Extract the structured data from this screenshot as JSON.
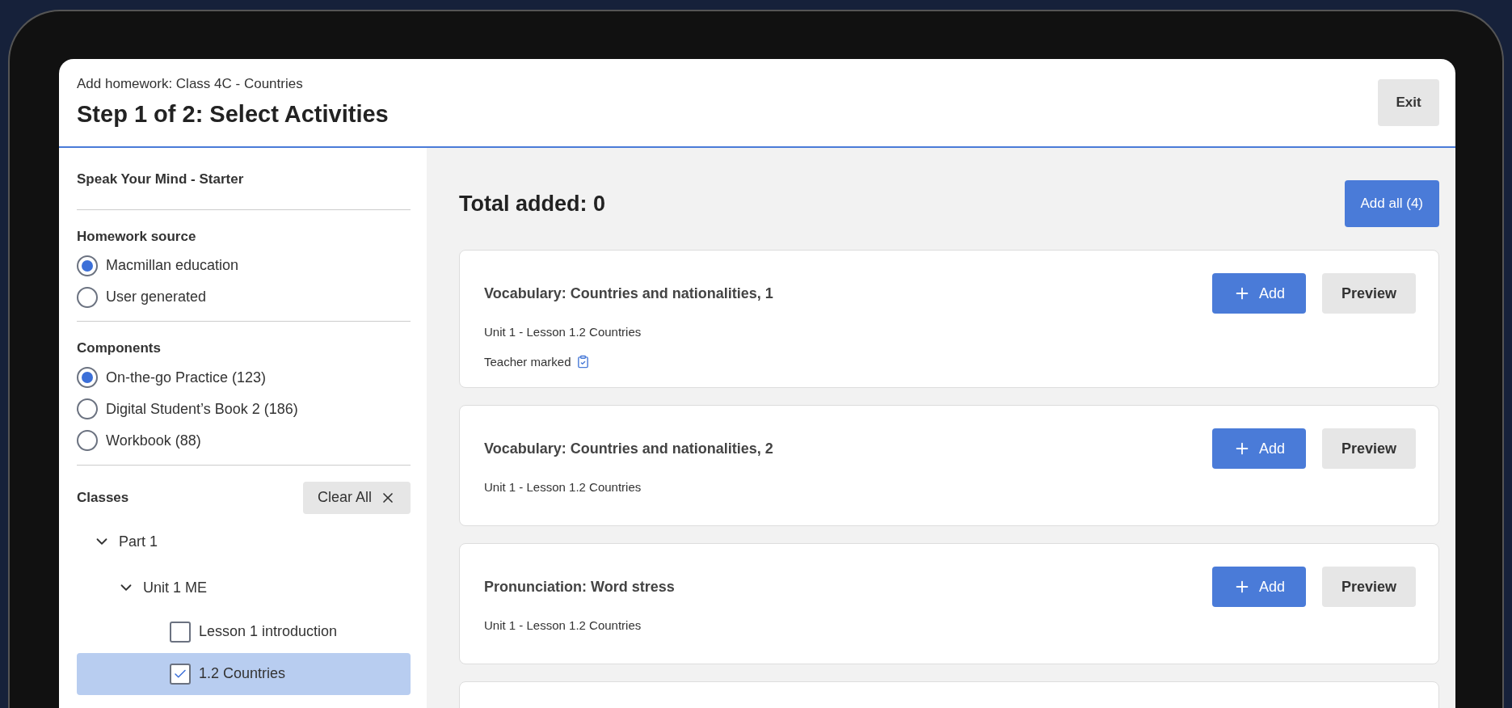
{
  "header": {
    "subtitle": "Add homework: Class 4C - Countries",
    "title": "Step 1 of 2: Select Activities",
    "exit_button": "Exit"
  },
  "sidebar": {
    "course": "Speak Your Mind - Starter",
    "groups": [
      {
        "heading": "Homework source",
        "options": [
          {
            "label": "Macmillan education",
            "selected": true
          },
          {
            "label": "User generated",
            "selected": false
          }
        ]
      },
      {
        "heading": "Components",
        "options": [
          {
            "label": "On-the-go Practice (123)",
            "selected": true
          },
          {
            "label": "Digital Student’s Book 2 (186)",
            "selected": false
          },
          {
            "label": "Workbook (88)",
            "selected": false
          }
        ]
      }
    ],
    "classes": {
      "heading": "Classes",
      "clear_button": "Clear All",
      "tree": [
        {
          "label": "Part 1",
          "expanded": true,
          "children": [
            {
              "label": "Unit 1 ME",
              "expanded": true,
              "children": [
                {
                  "label": "Lesson 1 introduction",
                  "checked": false,
                  "selected": false
                },
                {
                  "label": "1.2 Countries",
                  "checked": true,
                  "selected": true
                }
              ]
            }
          ]
        }
      ]
    }
  },
  "main": {
    "total": "Total added: 0",
    "add_all_button": "Add all (4)",
    "activities": [
      {
        "title": "Vocabulary: Countries and nationalities, 1",
        "lesson": "Unit 1 - Lesson 1.2 Countries",
        "note": "Teacher marked",
        "add_button": "Add",
        "preview_button": "Preview"
      },
      {
        "title": "Vocabulary: Countries and nationalities, 2",
        "lesson": "Unit 1 - Lesson 1.2 Countries",
        "add_button": "Add",
        "preview_button": "Preview"
      },
      {
        "title": "Pronunciation: Word stress",
        "lesson": "Unit 1 - Lesson 1.2 Countries",
        "add_button": "Add",
        "preview_button": "Preview"
      }
    ]
  }
}
